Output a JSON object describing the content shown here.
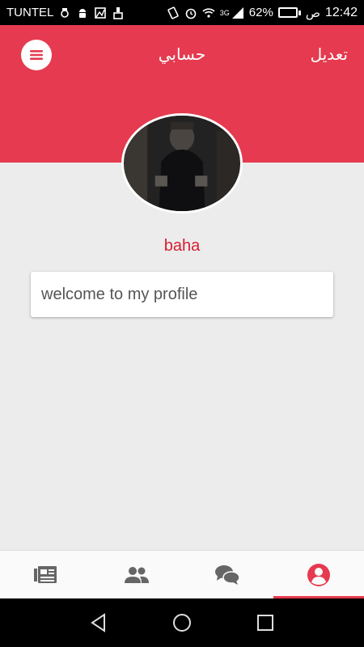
{
  "status_bar": {
    "carrier": "TUNTEL",
    "network": "3G",
    "battery": "62%",
    "battery_level": 0.62,
    "ampm": "ص",
    "time": "12:42"
  },
  "header": {
    "title": "حسابي",
    "edit_label": "تعديل",
    "color": "#e53a4f"
  },
  "profile": {
    "username": "baha",
    "bio": "welcome to my profile"
  },
  "tabs": [
    {
      "icon": "news-icon",
      "active": false
    },
    {
      "icon": "people-icon",
      "active": false
    },
    {
      "icon": "chat-icon",
      "active": false
    },
    {
      "icon": "profile-icon",
      "active": true
    }
  ],
  "colors": {
    "accent": "#e53a4f",
    "username": "#d41f34",
    "background": "#ececec"
  }
}
